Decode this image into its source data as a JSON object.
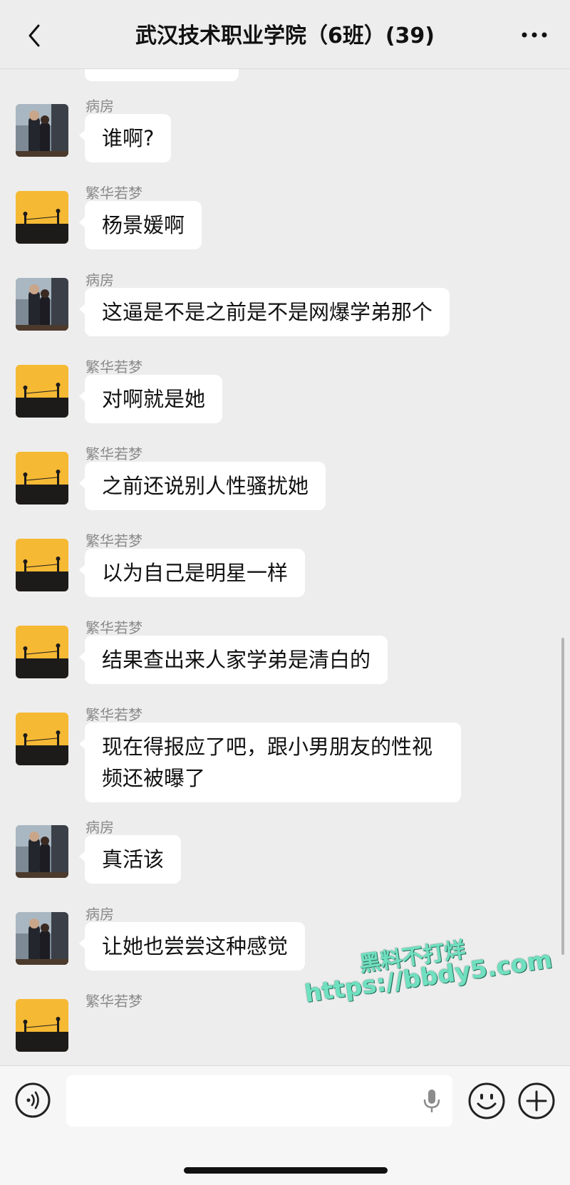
{
  "header": {
    "title": "武汉技术职业学院（6班）(39)"
  },
  "messages": [
    {
      "sender": "病房",
      "avatar": "couple-photo",
      "text": "谁啊?"
    },
    {
      "sender": "繁华若梦",
      "avatar": "sunset-silhouette",
      "text": "杨景媛啊"
    },
    {
      "sender": "病房",
      "avatar": "couple-photo",
      "text": "这逼是不是之前是不是网爆学弟那个"
    },
    {
      "sender": "繁华若梦",
      "avatar": "sunset-silhouette",
      "text": "对啊就是她"
    },
    {
      "sender": "繁华若梦",
      "avatar": "sunset-silhouette",
      "text": "之前还说别人性骚扰她"
    },
    {
      "sender": "繁华若梦",
      "avatar": "sunset-silhouette",
      "text": "以为自己是明星一样"
    },
    {
      "sender": "繁华若梦",
      "avatar": "sunset-silhouette",
      "text": "结果查出来人家学弟是清白的"
    },
    {
      "sender": "繁华若梦",
      "avatar": "sunset-silhouette",
      "text": "现在得报应了吧，跟小男朋友的性视频还被曝了"
    },
    {
      "sender": "病房",
      "avatar": "couple-photo",
      "text": "真活该"
    },
    {
      "sender": "病房",
      "avatar": "couple-photo",
      "text": "让她也尝尝这种感觉"
    },
    {
      "sender": "繁华若梦",
      "avatar": "sunset-silhouette",
      "text": ""
    }
  ],
  "watermark": {
    "line1": "黑料不打烊",
    "line2": "https://bbdy5.com"
  },
  "colors": {
    "background": "#ededed",
    "bubble": "#ffffff",
    "watermark": "#6fe0c0"
  }
}
